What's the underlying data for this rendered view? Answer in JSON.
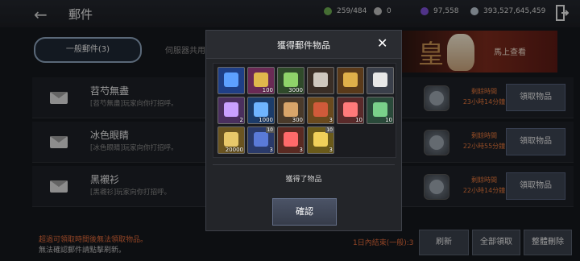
{
  "header": {
    "title": "郵件",
    "back_icon": "←",
    "stat1": "259/484",
    "stat2": "0",
    "stat3": "97,558",
    "stat4": "393,527,645,459"
  },
  "tabs": {
    "general": "一般郵件(3)",
    "server": "伺服器共用"
  },
  "banner": {
    "text": "皇",
    "link": "馬上查看"
  },
  "mails": [
    {
      "name": "苕芍無盡",
      "desc": "[苕芍無盡]玩家向你打招呼。",
      "time_label": "剩餘時間",
      "time": "23小時14分鐘",
      "button": "領取物品"
    },
    {
      "name": "冰色眼睛",
      "desc": "[冰色眼睛]玩家向你打招呼。",
      "time_label": "剩餘時間",
      "time": "22小時55分鐘",
      "button": "領取物品"
    },
    {
      "name": "黑襯衫",
      "desc": "[黑襯衫]玩家向你打招呼。",
      "time_label": "剩餘時間",
      "time": "22小時14分鐘",
      "button": "領取物品"
    }
  ],
  "footer": {
    "warn": "超過可領取時間後無法領取物品。",
    "note": "無法確認郵件請點擊刷新。",
    "status": "1日內結束(一般):3",
    "refresh": "刷新",
    "claim_all": "全部領取",
    "delete_all": "整體刪除"
  },
  "modal": {
    "title": "獲得郵件物品",
    "close": "✕",
    "message": "獲得了物品",
    "confirm": "確認",
    "items": [
      {
        "count": "",
        "tag": ""
      },
      {
        "count": "100",
        "tag": ""
      },
      {
        "count": "3000",
        "tag": ""
      },
      {
        "count": "",
        "tag": ""
      },
      {
        "count": "",
        "tag": ""
      },
      {
        "count": "",
        "tag": ""
      },
      {
        "count": "2",
        "tag": ""
      },
      {
        "count": "1000",
        "tag": ""
      },
      {
        "count": "300",
        "tag": ""
      },
      {
        "count": "3",
        "tag": ""
      },
      {
        "count": "10",
        "tag": ""
      },
      {
        "count": "10",
        "tag": ""
      },
      {
        "count": "20000",
        "tag": ""
      },
      {
        "count": "3",
        "tag": "10"
      },
      {
        "count": "3",
        "tag": ""
      },
      {
        "count": "3",
        "tag": "10"
      }
    ]
  },
  "colors": {
    "accent_orange": "#e06a3a",
    "button_bg": "#3b4250"
  }
}
